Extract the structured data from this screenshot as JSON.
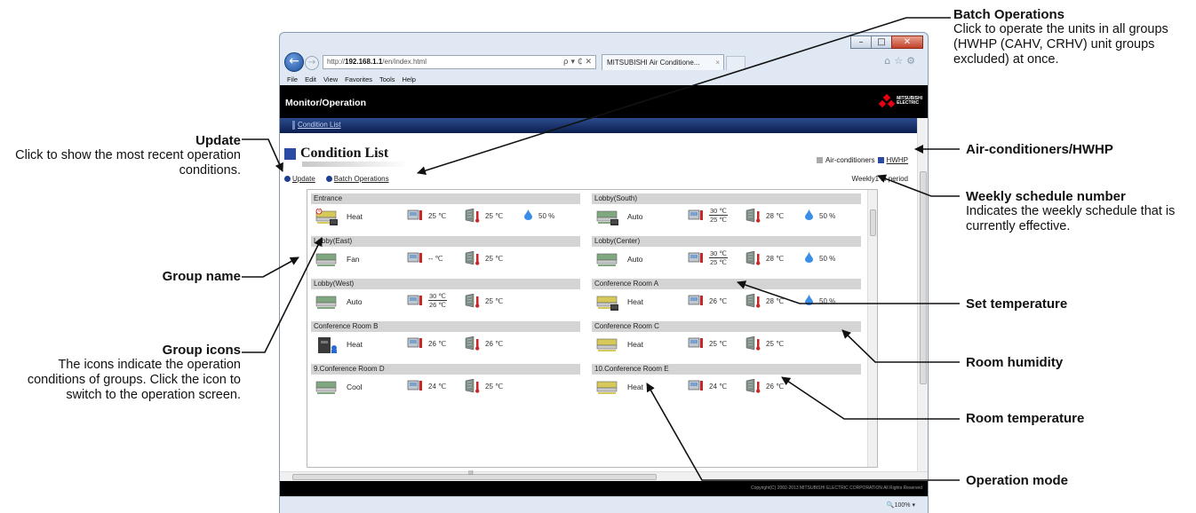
{
  "browser": {
    "url_prefix": "http://",
    "url_host": "192.168.1.1",
    "url_path": "/en/index.html",
    "address_tools": "ρ ▾ ₵ ✕",
    "tab_title": "MITSUBISHI Air Conditione...",
    "tab_close": "×",
    "menu": [
      "File",
      "Edit",
      "View",
      "Favorites",
      "Tools",
      "Help"
    ],
    "zoom": "100%",
    "caption_min": "–",
    "caption_max": "□",
    "caption_close": "✕"
  },
  "header": {
    "title": "Monitor/Operation",
    "logo_line1": "MITSUBISHI",
    "logo_line2": "ELECTRIC"
  },
  "nav": {
    "condition_list": "Condition List"
  },
  "page": {
    "title": "Condition List",
    "legend_ac": "Air-conditioners",
    "legend_hwhp": "HWHP",
    "update": "Update",
    "batch": "Batch Operations",
    "period": "Weekly1 in period",
    "scroll_mid": "III",
    "copyright": "Copyright(C) 2002-2013 MITSUBISHI ELECTRIC CORPORATION All Rights Reserved"
  },
  "groups": [
    {
      "name": "Entrance",
      "mode": "Heat",
      "set": "25 ℃",
      "room": "25 ℃",
      "humidity": "50 %"
    },
    {
      "name": "Lobby(South)",
      "mode": "Auto",
      "set_top": "30 ℃",
      "set_bottom": "25 ℃",
      "room": "28 ℃",
      "humidity": "50 %"
    },
    {
      "name": "Lobby(East)",
      "mode": "Fan",
      "set": "-- ℃",
      "room": "25 ℃"
    },
    {
      "name": "Lobby(Center)",
      "mode": "Auto",
      "set_top": "30 ℃",
      "set_bottom": "25 ℃",
      "room": "28 ℃",
      "humidity": "50 %"
    },
    {
      "name": "Lobby(West)",
      "mode": "Auto",
      "set_top": "30 ℃",
      "set_bottom": "26 ℃",
      "room": "25 ℃"
    },
    {
      "name": "Conference Room A",
      "mode": "Heat",
      "set": "26 ℃",
      "room": "28 ℃",
      "humidity": "50 %"
    },
    {
      "name": "Conference Room B",
      "mode": "Heat",
      "set": "26 ℃",
      "room": "26 ℃"
    },
    {
      "name": "Conference Room C",
      "mode": "Heat",
      "set": "25 ℃",
      "room": "25 ℃"
    },
    {
      "name": "9.Conference Room D",
      "mode": "Cool",
      "set": "24 ℃",
      "room": "25 ℃"
    },
    {
      "name": "10.Conference Room E",
      "mode": "Heat",
      "set": "24 ℃",
      "room": "26 ℃"
    }
  ],
  "callouts": {
    "batch_head": "Batch Operations",
    "batch_body": "Click to operate the units in all groups (HWHP (CAHV, CRHV) unit groups excluded) at once.",
    "ac_head": "Air-conditioners/HWHP",
    "weekly_head": "Weekly schedule number",
    "weekly_body": "Indicates the weekly schedule that is currently effective.",
    "set_head": "Set temperature",
    "hum_head": "Room humidity",
    "room_head": "Room temperature",
    "mode_head": "Operation mode",
    "update_head": "Update",
    "update_body": "Click to show the most recent operation conditions.",
    "group_name_head": "Group name",
    "group_icons_head": "Group icons",
    "group_icons_body": "The icons indicate the operation conditions of groups. Click the icon to switch to the operation screen."
  },
  "colors": {
    "accent_blue": "#2a4aa3",
    "header_black": "#000000",
    "nav_gradient_top": "#2d4c8f",
    "droplet": "#3b8ee8",
    "logo_red": "#e60012"
  }
}
